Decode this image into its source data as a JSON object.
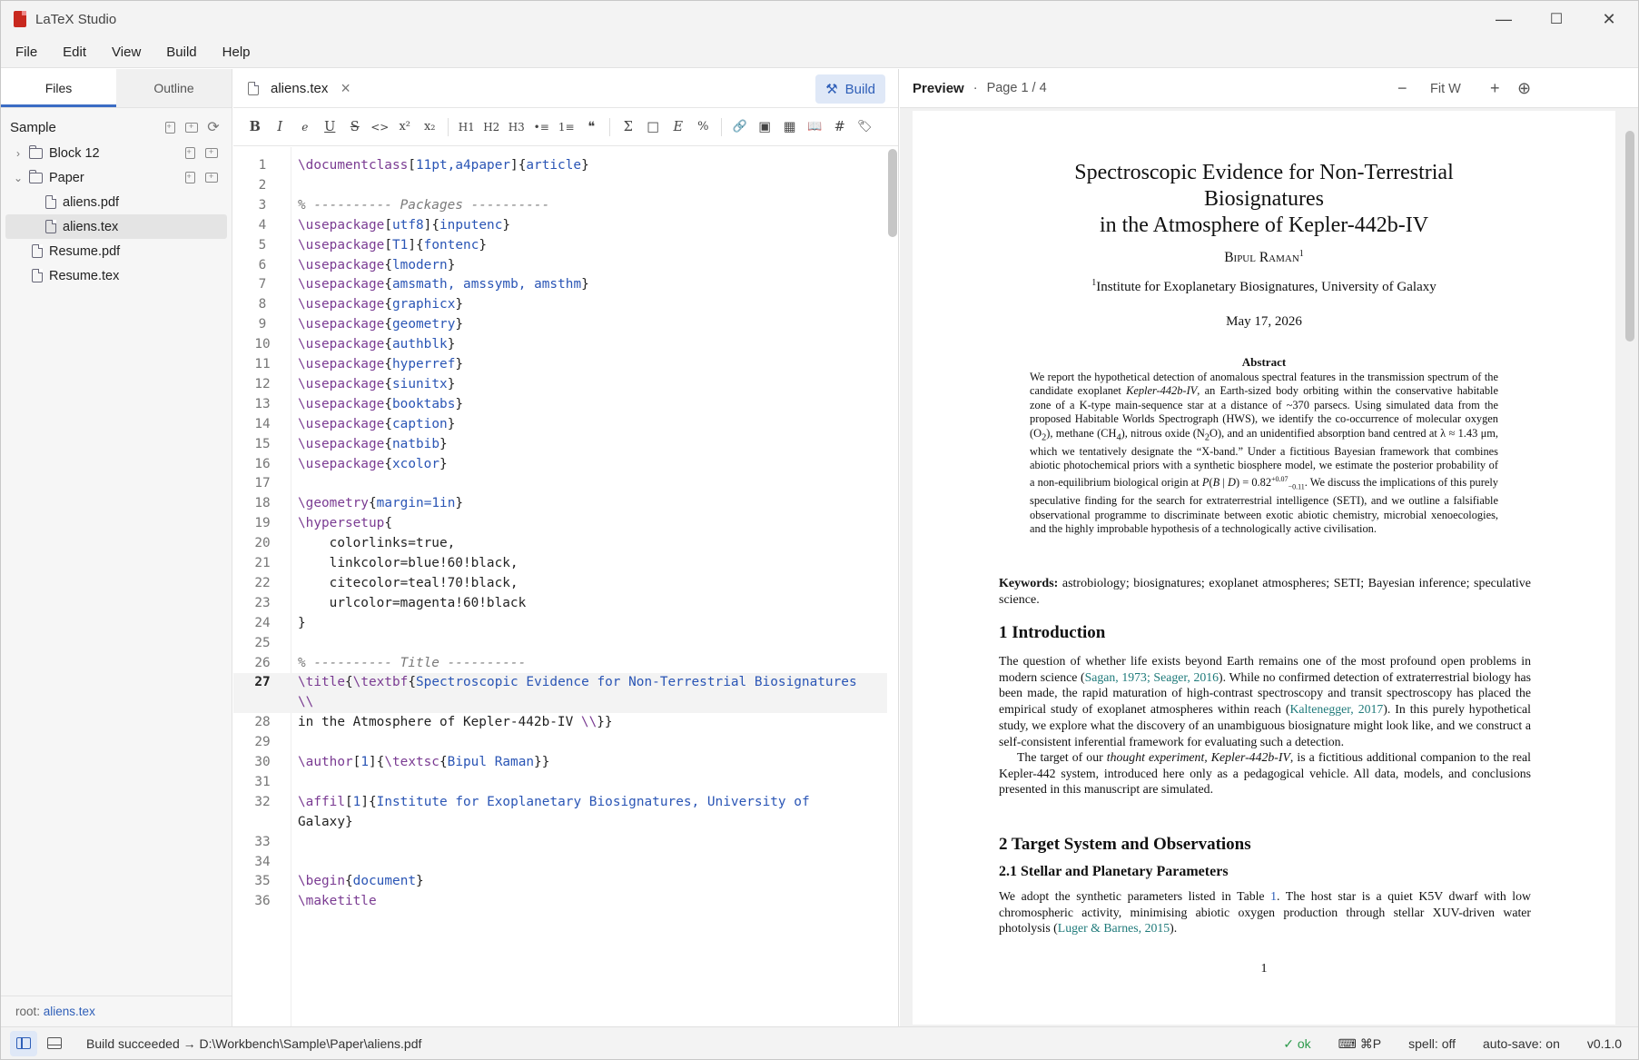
{
  "window": {
    "title": "LaTeX Studio",
    "minimize": "—",
    "maximize": "☐",
    "close": "✕"
  },
  "menu": [
    "File",
    "Edit",
    "View",
    "Build",
    "Help"
  ],
  "sidebar": {
    "tabs": [
      "Files",
      "Outline"
    ],
    "project": "Sample",
    "tree": [
      {
        "label": "Block 12",
        "kind": "folder",
        "expanded": false
      },
      {
        "label": "Paper",
        "kind": "folder",
        "expanded": true
      },
      {
        "label": "aliens.pdf",
        "kind": "file"
      },
      {
        "label": "aliens.tex",
        "kind": "file",
        "selected": true
      },
      {
        "label": "Resume.pdf",
        "kind": "file"
      },
      {
        "label": "Resume.tex",
        "kind": "file"
      }
    ],
    "footer_prefix": "root:",
    "footer_file": "aliens.tex"
  },
  "editor": {
    "tab": "aliens.tex",
    "build_label": "Build",
    "toolbar": [
      "B",
      "I",
      "e",
      "U",
      "S",
      "<>",
      "x²",
      "x₂",
      "H1",
      "H2",
      "H3",
      "•≡",
      "1≡",
      "❝",
      "Σ",
      "□",
      "E",
      "%",
      "🔗",
      "▣",
      "▦",
      "📖",
      "#",
      "🏷"
    ],
    "current_line": "27",
    "lines": [
      {
        "n": "1",
        "t": "\\documentclass[11pt,a4paper]{article}"
      },
      {
        "n": "2",
        "t": ""
      },
      {
        "n": "3",
        "t": "% ---------- Packages ----------"
      },
      {
        "n": "4",
        "t": "\\usepackage[utf8]{inputenc}"
      },
      {
        "n": "5",
        "t": "\\usepackage[T1]{fontenc}"
      },
      {
        "n": "6",
        "t": "\\usepackage{lmodern}"
      },
      {
        "n": "7",
        "t": "\\usepackage{amsmath, amssymb, amsthm}"
      },
      {
        "n": "8",
        "t": "\\usepackage{graphicx}"
      },
      {
        "n": "9",
        "t": "\\usepackage{geometry}"
      },
      {
        "n": "10",
        "t": "\\usepackage{authblk}"
      },
      {
        "n": "11",
        "t": "\\usepackage{hyperref}"
      },
      {
        "n": "12",
        "t": "\\usepackage{siunitx}"
      },
      {
        "n": "13",
        "t": "\\usepackage{booktabs}"
      },
      {
        "n": "14",
        "t": "\\usepackage{caption}"
      },
      {
        "n": "15",
        "t": "\\usepackage{natbib}"
      },
      {
        "n": "16",
        "t": "\\usepackage{xcolor}"
      },
      {
        "n": "17",
        "t": ""
      },
      {
        "n": "18",
        "t": "\\geometry{margin=1in}"
      },
      {
        "n": "19",
        "t": "\\hypersetup{"
      },
      {
        "n": "20",
        "t": "    colorlinks=true,"
      },
      {
        "n": "21",
        "t": "    linkcolor=blue!60!black,"
      },
      {
        "n": "22",
        "t": "    citecolor=teal!70!black,"
      },
      {
        "n": "23",
        "t": "    urlcolor=magenta!60!black"
      },
      {
        "n": "24",
        "t": "}"
      },
      {
        "n": "25",
        "t": ""
      },
      {
        "n": "26",
        "t": "% ---------- Title ----------"
      },
      {
        "n": "27",
        "t": "\\title{\\textbf{Spectroscopic Evidence for Non-Terrestrial Biosignatures",
        "cont": "\\\\"
      },
      {
        "n": "28",
        "t": "in the Atmosphere of Kepler-442b-IV \\\\}}"
      },
      {
        "n": "29",
        "t": ""
      },
      {
        "n": "30",
        "t": "\\author[1]{\\textsc{Bipul Raman}}"
      },
      {
        "n": "31",
        "t": ""
      },
      {
        "n": "32",
        "t": "\\affil[1]{Institute for Exoplanetary Biosignatures, University of",
        "cont": "Galaxy}"
      },
      {
        "n": "33",
        "t": ""
      },
      {
        "n": "34",
        "t": ""
      },
      {
        "n": "35",
        "t": "\\begin{document}"
      },
      {
        "n": "36",
        "t": "\\maketitle"
      }
    ]
  },
  "preview": {
    "title": "Preview",
    "sep": "·",
    "page_label": "Page 1 / 4",
    "zoom_out": "−",
    "fit": "Fit W",
    "zoom_in": "+",
    "zoom_tool": "⊕",
    "doc": {
      "title_lines": [
        "Spectroscopic Evidence for Non-Terrestrial",
        "Biosignatures",
        "in the Atmosphere of Kepler-442b-IV"
      ],
      "author": "Bipul Raman",
      "author_sup": "1",
      "affil_sup": "1",
      "affil": "Institute for Exoplanetary Biosignatures, University of Galaxy",
      "date": "May 17, 2026",
      "abstract_heading": "Abstract",
      "abstract": "We report the hypothetical detection of anomalous spectral features in the transmission spectrum of the candidate exoplanet Kepler-442b-IV, an Earth-sized body orbiting within the conservative habitable zone of a K-type main-sequence star at a distance of ~370 parsecs. Using simulated data from the proposed Habitable Worlds Spectrograph (HWS), we identify the co-occurrence of molecular oxygen (O2), methane (CH4), nitrous oxide (N2O), and an unidentified absorption band centred at λ ≈ 1.43 μm, which we tentatively designate the “X-band.” Under a fictitious Bayesian framework that combines abiotic photochemical priors with a synthetic biosphere model, we estimate the posterior probability of a non-equilibrium biological origin at P(B | D) = 0.82 +0.07 −0.11. We discuss the implications of this purely speculative finding for the search for extraterrestrial intelligence (SETI), and we outline a falsifiable observational programme to discriminate between exotic abiotic chemistry, microbial xenoecologies, and the highly improbable hypothesis of a technologically active civilisation.",
      "keywords_label": "Keywords:",
      "keywords": "astrobiology; biosignatures; exoplanet atmospheres; SETI; Bayesian inference; speculative science.",
      "sec1": "1   Introduction",
      "p1a": "The question of whether life exists beyond Earth remains one of the most profound open problems in modern science (",
      "cite1": "Sagan, 1973; Seager, 2016",
      "p1b": "). While no confirmed detection of extraterrestrial biology has been made, the rapid maturation of high-contrast spectroscopy and transit spectroscopy has placed the empirical study of exoplanet atmospheres within reach (",
      "cite2": "Kaltenegger, 2017",
      "p1c": "). In this purely hypothetical study, we explore what the discovery of an unambiguous biosignature might look like, and we construct a self-consistent inferential framework for evaluating such a detection.",
      "p2a": "The target of our ",
      "p2em": "thought experiment, Kepler-442b-IV",
      "p2b": ", is a fictitious additional companion to the real Kepler-442 system, introduced here only as a pedagogical vehicle. All data, models, and conclusions presented in this manuscript are simulated.",
      "sec2": "2   Target System and Observations",
      "sec21": "2.1   Stellar and Planetary Parameters",
      "p3a": "We adopt the synthetic parameters listed in Table ",
      "ref1": "1",
      "p3b": ". The host star is a quiet K5V dwarf with low chromospheric activity, minimising abiotic oxygen production through stellar XUV-driven water photolysis (",
      "cite3": "Luger & Barnes, 2015",
      "p3c": ").",
      "page_number": "1"
    }
  },
  "status": {
    "message": "Build succeeded → D:\\Workbench\\Sample\\Paper\\aliens.pdf",
    "ok": "ok",
    "keys": "⌘P",
    "spell": "spell: off",
    "autosave": "auto-save: on",
    "version": "v0.1.0"
  }
}
